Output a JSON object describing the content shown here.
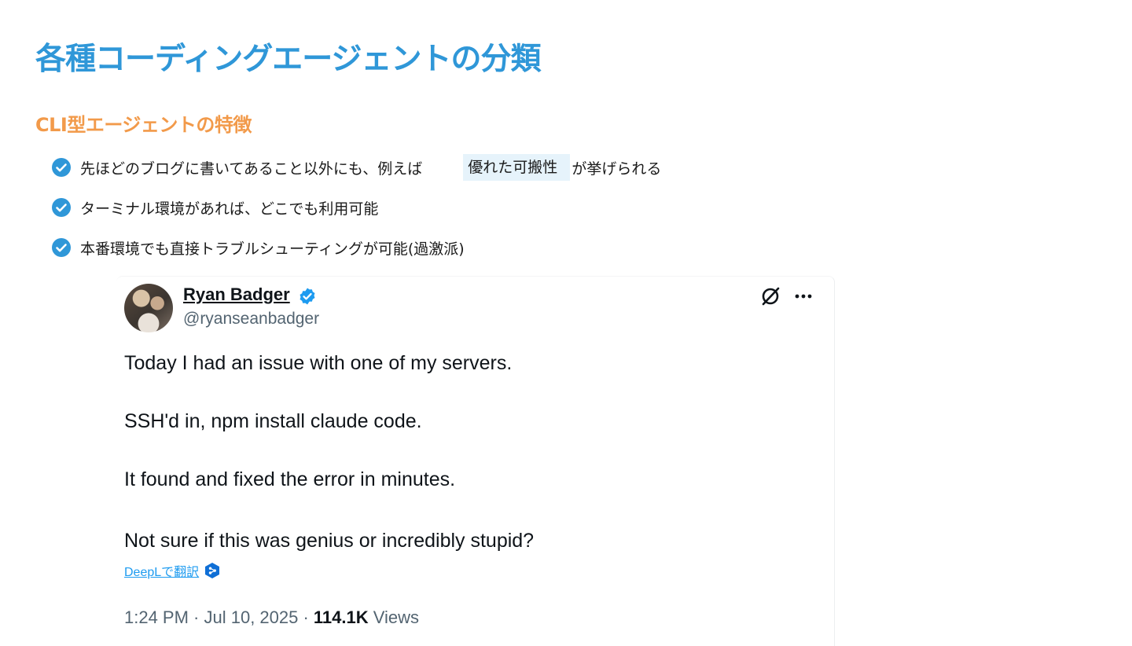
{
  "slide": {
    "title": "各種コーディングエージェントの分類",
    "section_title": "CLI型エージェントの特徴",
    "bullets": [
      {
        "text_before": "先ほどのブログに書いてあること以外にも、例えば",
        "highlight": "優れた可搬性",
        "text_after": "が挙げられる"
      },
      {
        "text": "ターミナル環境があれば、どこでも利用可能"
      },
      {
        "text": "本番環境でも直接トラブルシューティングが可能(過激派)"
      }
    ],
    "colors": {
      "title": "#2f97d8",
      "section_title": "#f29a4a",
      "check_icon": "#2f97d8",
      "highlight_bg": "#e6f3fb"
    },
    "bullet_icon": "check-circle-icon"
  },
  "tweet": {
    "author_name": "Ryan Badger",
    "handle": "@ryanseanbadger",
    "verified_icon": "verified-badge-icon",
    "text_lines": [
      "Today I had an issue with one of my servers.",
      "SSH'd in, npm install claude code.",
      "It found and fixed the error in minutes.",
      "Not sure if this was genius or incredibly stupid?"
    ],
    "translate_label": "DeepLで翻訳",
    "time": "1:24 PM · Jul 10, 2025 · ",
    "views_count": "114.1K",
    "views_label": " Views",
    "icons": [
      "grok-icon",
      "more-icon",
      "deepl-icon"
    ],
    "colors": {
      "verified": "#1d9bf0",
      "link": "#1d9bf0",
      "secondary_text": "#536471"
    }
  }
}
